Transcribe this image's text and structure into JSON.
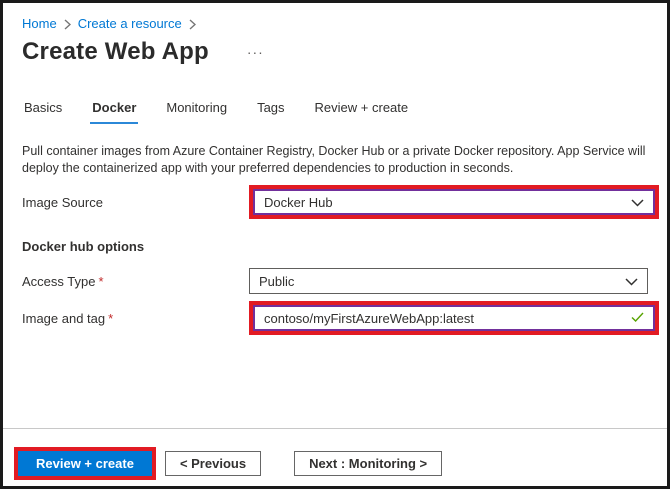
{
  "breadcrumb": {
    "items": [
      {
        "label": "Home"
      },
      {
        "label": "Create a resource"
      }
    ]
  },
  "header": {
    "title": "Create Web App",
    "more_actions": "···"
  },
  "tabs": [
    {
      "label": "Basics"
    },
    {
      "label": "Docker"
    },
    {
      "label": "Monitoring"
    },
    {
      "label": "Tags"
    },
    {
      "label": "Review + create"
    }
  ],
  "active_tab": "Docker",
  "description": "Pull container images from Azure Container Registry, Docker Hub or a private Docker repository. App Service will deploy the containerized app with your preferred dependencies to production in seconds.",
  "form": {
    "image_source": {
      "label": "Image Source",
      "value": "Docker Hub"
    },
    "section_title": "Docker hub options",
    "access_type": {
      "label": "Access Type",
      "required_mark": "*",
      "value": "Public"
    },
    "image_and_tag": {
      "label": "Image and tag",
      "required_mark": "*",
      "value": "contoso/myFirstAzureWebApp:latest",
      "valid": true
    }
  },
  "footer": {
    "review_create_label": "Review + create",
    "previous_label": "< Previous",
    "next_label": "Next : Monitoring >"
  },
  "colors": {
    "accent_blue": "#0078d4",
    "annotation_red": "#e21b23",
    "focus_purple": "#72309c",
    "valid_green": "#57a300",
    "text": "#323130"
  }
}
